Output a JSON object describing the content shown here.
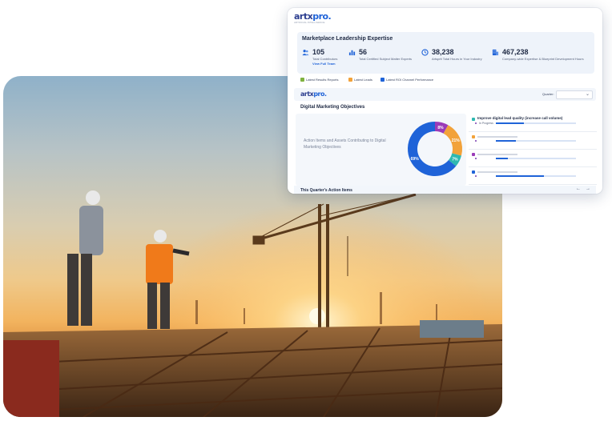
{
  "logo": {
    "part1": "artx",
    "part2": "pro.",
    "tagline": "ARTIFICIAL INTELLIGENCE"
  },
  "leadership": {
    "title": "Marketplace Leadership Expertise",
    "stats": [
      {
        "icon": "users-icon",
        "value": "105",
        "label": "Total Contributors",
        "link": "View Full Team"
      },
      {
        "icon": "bar-chart-icon",
        "value": "56",
        "label": "Total Certified Subject Matter Experts"
      },
      {
        "icon": "clock-icon",
        "value": "38,238",
        "label": "Artsprit Total Hours in Your Industry"
      },
      {
        "icon": "building-icon",
        "value": "467,238",
        "label": "Company-wide Expertise & Blueprint Development Hours"
      }
    ]
  },
  "tabs": [
    {
      "icon": "report-icon",
      "label": "Latest Results Reports",
      "color": "#7fb23f"
    },
    {
      "icon": "leads-icon",
      "label": "Latest Leads",
      "color": "#f2a23a"
    },
    {
      "icon": "trend-icon",
      "label": "Latest ROI Channel Performance",
      "color": "#1f63d8"
    }
  ],
  "quarter": {
    "label": "Quarter:"
  },
  "objectives": {
    "title": "Digital Marketing Objectives",
    "description": "Action Items and Assets Contributing to Digital Marketing Objectives",
    "donut": [
      {
        "label": "8%",
        "value": 8,
        "color": "#9b3bb8"
      },
      {
        "label": "21%",
        "value": 21,
        "color": "#f2a23a"
      },
      {
        "label": "7%",
        "value": 7,
        "color": "#2eb8b0"
      },
      {
        "label": "69%",
        "value": 64,
        "color": "#1f63d8"
      }
    ],
    "items": [
      {
        "title": "Improve digital lead quality (increase call volume)",
        "status": "In Progress",
        "color": "#2eb8b0",
        "progress": 0.35
      },
      {
        "title": "",
        "status": "",
        "color": "#f2a23a",
        "progress": 0.25
      },
      {
        "title": "",
        "status": "",
        "color": "#9b3bb8",
        "progress": 0.15
      },
      {
        "title": "",
        "status": "",
        "color": "#1f63d8",
        "progress": 0.6
      }
    ]
  },
  "actions": {
    "title": "This Quarter's Action Items",
    "prev": "←",
    "next": "→"
  }
}
